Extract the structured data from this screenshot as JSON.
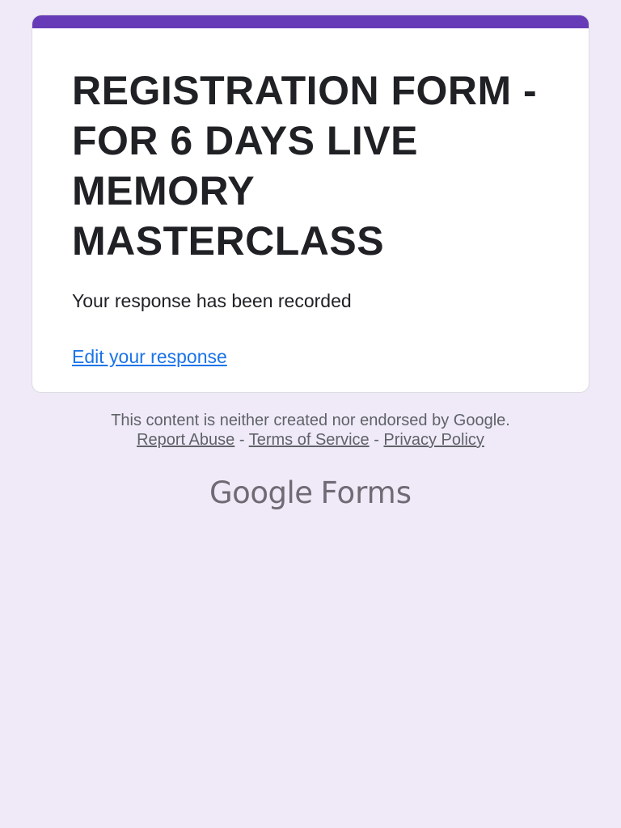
{
  "form": {
    "title": "REGISTRATION FORM - FOR 6 DAYS LIVE MEMORY MASTERCLASS",
    "confirmation_message": "Your response has been recorded",
    "edit_link_label": "Edit your response"
  },
  "footer": {
    "disclaimer": "This content is neither created nor endorsed by Google.",
    "links": {
      "report_abuse": "Report Abuse",
      "terms_of_service": "Terms of Service",
      "privacy_policy": "Privacy Policy"
    },
    "separator": "-"
  },
  "brand": {
    "google": "Google",
    "forms": "Forms"
  },
  "colors": {
    "accent": "#673ab7",
    "background": "#efe9f8",
    "link": "#1a73e8"
  }
}
